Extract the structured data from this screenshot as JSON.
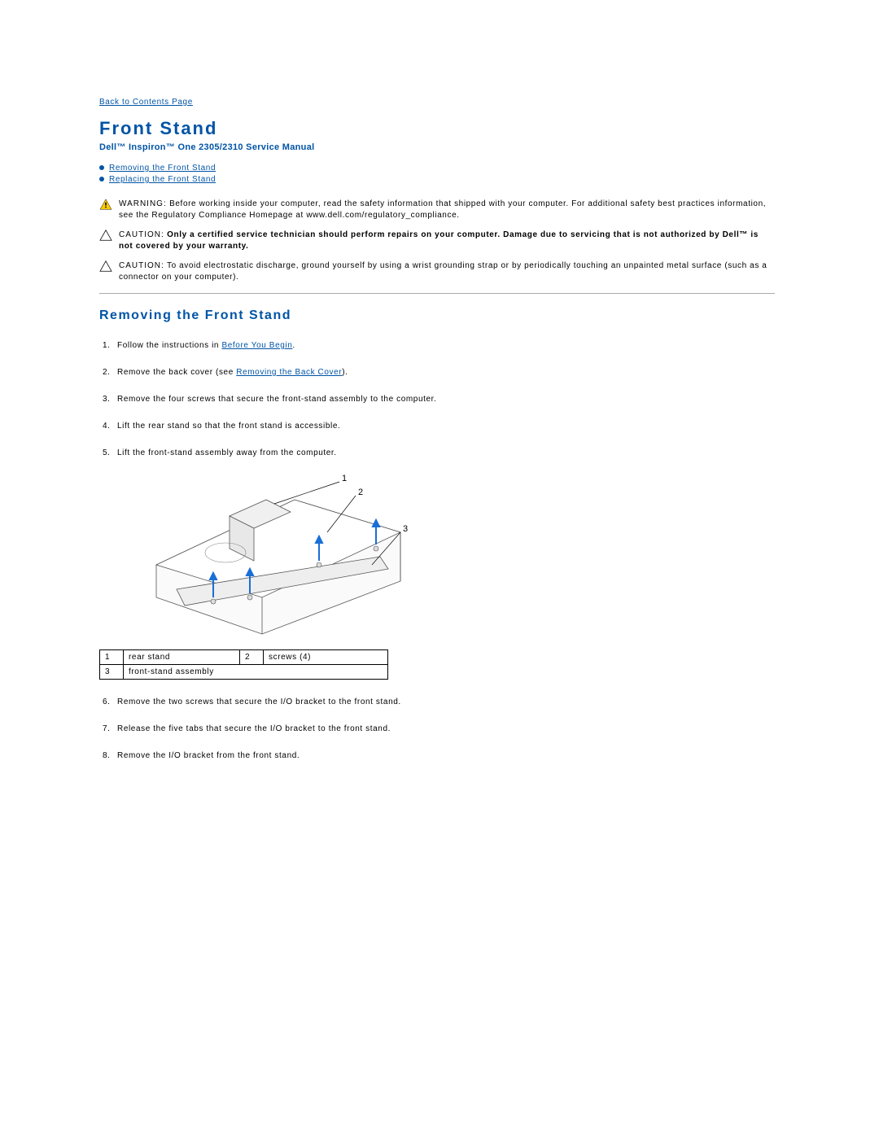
{
  "nav": {
    "back_link": "Back to Contents Page"
  },
  "header": {
    "title": "Front Stand",
    "subtitle": "Dell™ Inspiron™ One 2305/2310 Service Manual"
  },
  "toc": {
    "items": [
      {
        "label": "Removing the Front Stand"
      },
      {
        "label": "Replacing the Front Stand"
      }
    ]
  },
  "notices": {
    "warning_label": "WARNING:",
    "warning_text": " Before working inside your computer, read the safety information that shipped with your computer. For additional safety best practices information, see the Regulatory Compliance Homepage at www.dell.com/regulatory_compliance.",
    "caution1_label": "CAUTION:",
    "caution1_text": " Only a certified service technician should perform repairs on your computer. Damage due to servicing that is not authorized by Dell™ is not covered by your warranty.",
    "caution2_label": "CAUTION:",
    "caution2_text": " To avoid electrostatic discharge, ground yourself by using a wrist grounding strap or by periodically touching an unpainted metal surface (such as a connector on your computer)."
  },
  "section": {
    "title": "Removing the Front Stand"
  },
  "steps": {
    "s1_prefix": "Follow the instructions in ",
    "s1_link": "Before You Begin",
    "s1_suffix": ".",
    "s2_prefix": "Remove the back cover (see ",
    "s2_link": "Removing the Back Cover",
    "s2_suffix": ").",
    "s3": "Remove the four screws that secure the front-stand assembly to the computer.",
    "s4": "Lift the rear stand so that the front stand is accessible.",
    "s5": "Lift the front-stand assembly away from the computer.",
    "s6": "Remove the two screws that secure the I/O bracket to the front stand.",
    "s7": "Release the five tabs that secure the I/O bracket to the front stand.",
    "s8": "Remove the I/O bracket from the front stand."
  },
  "callouts": {
    "c1": "1",
    "c2": "2",
    "c3": "3"
  },
  "parts": {
    "r1n": "1",
    "r1l": "rear stand",
    "r2n": "2",
    "r2l": "screws (4)",
    "r3n": "3",
    "r3l": "front-stand assembly"
  }
}
